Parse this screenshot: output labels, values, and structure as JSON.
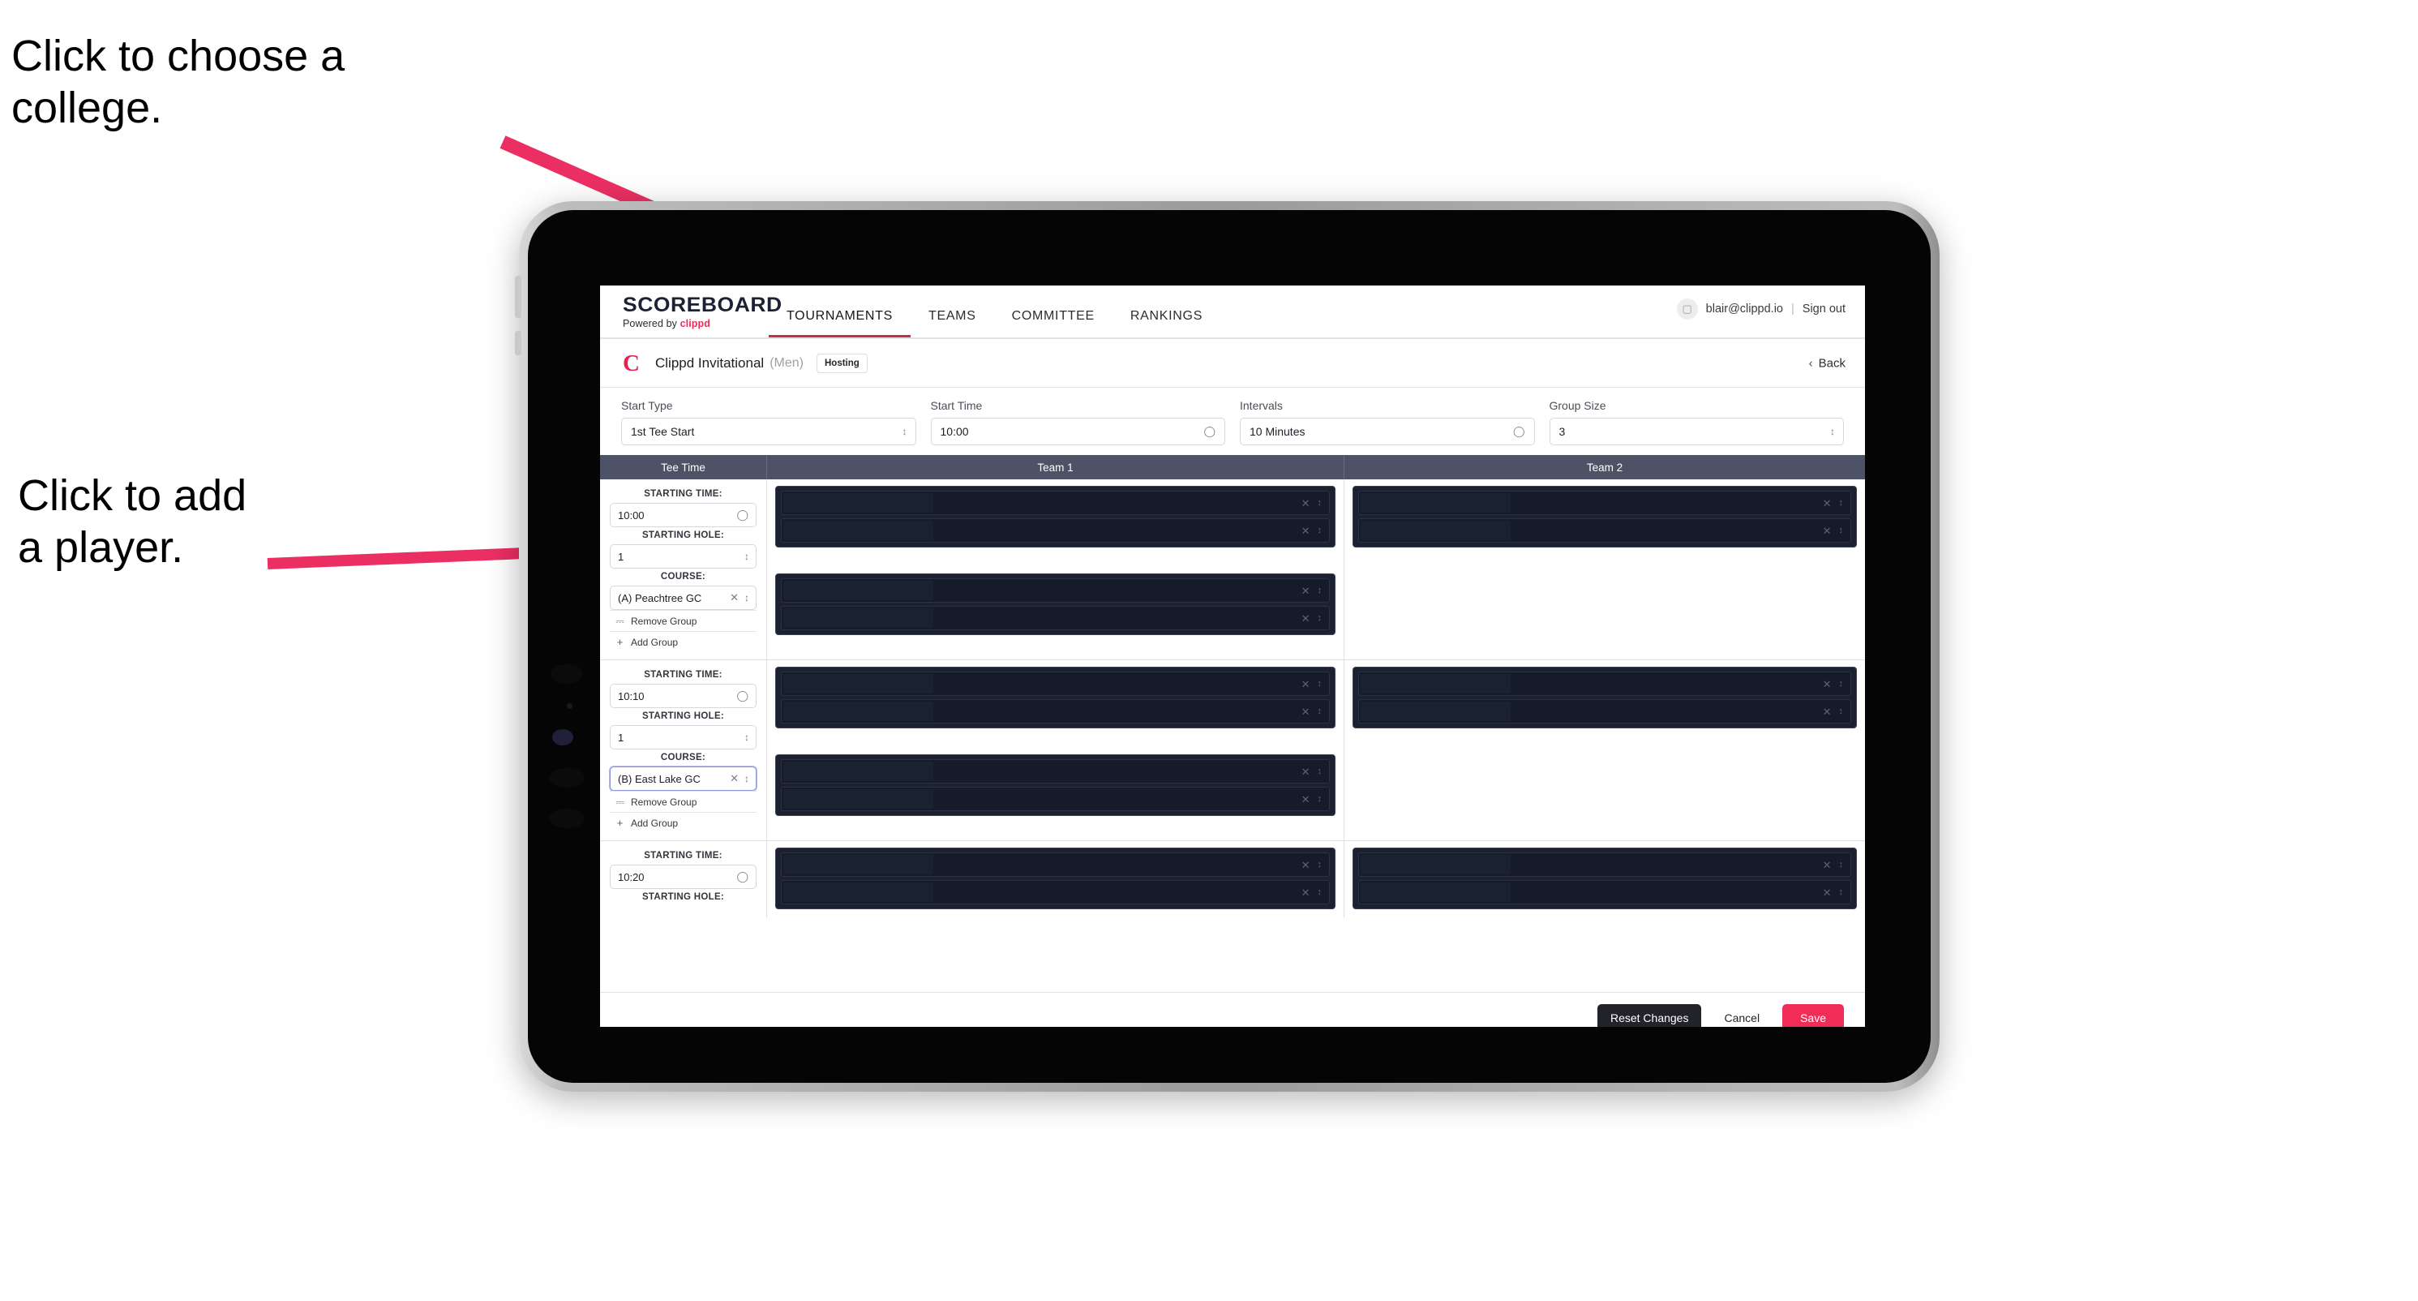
{
  "annotations": {
    "college": "Click to choose a\ncollege.",
    "player": "Click to add\na player.",
    "arrow_color": "#ec2f63"
  },
  "brand": {
    "wordmark": "SCOREBOARD",
    "tagline_prefix": "Powered by ",
    "tagline_brand": "clippd"
  },
  "nav": {
    "tabs": [
      {
        "label": "TOURNAMENTS",
        "active": true
      },
      {
        "label": "TEAMS",
        "active": false
      },
      {
        "label": "COMMITTEE",
        "active": false
      },
      {
        "label": "RANKINGS",
        "active": false
      }
    ]
  },
  "account": {
    "avatar_icon": "user-badge-icon",
    "email": "blair@clippd.io",
    "separator": "|",
    "sign_out": "Sign out"
  },
  "tournament": {
    "logo_letter": "C",
    "name": "Clippd Invitational",
    "gender": "(Men)",
    "badge": "Hosting",
    "back_label": "Back",
    "back_icon": "chevron-left-icon"
  },
  "settings": {
    "fields": [
      {
        "label": "Start Type",
        "value": "1st Tee Start",
        "icon": "stepper-icon"
      },
      {
        "label": "Start Time",
        "value": "10:00",
        "icon": "clock-icon"
      },
      {
        "label": "Intervals",
        "value": "10 Minutes",
        "icon": "clock-icon"
      },
      {
        "label": "Group Size",
        "value": "3",
        "icon": "stepper-icon"
      }
    ]
  },
  "table": {
    "headers": {
      "tee_time": "Tee Time",
      "team1": "Team 1",
      "team2": "Team 2"
    },
    "labels": {
      "starting_time": "STARTING TIME:",
      "starting_hole": "STARTING HOLE:",
      "course": "COURSE:",
      "remove_group": "Remove Group",
      "add_group": "Add Group",
      "remove_group_icon": "trash-icon",
      "add_group_icon": "plus-icon",
      "clock_icon": "clock-icon",
      "stepper_icon": "stepper-icon",
      "clear_icon": "close-x-icon",
      "player_clear_icon": "close-x-icon",
      "player_stepper_icon": "stepper-icon"
    },
    "rows": [
      {
        "starting_time": "10:00",
        "starting_hole": "1",
        "course": "(A) Peachtree GC",
        "course_focused": false,
        "team1_groups": [
          {
            "players": [
              "",
              ""
            ]
          },
          {
            "players": [
              "",
              ""
            ]
          }
        ],
        "team2_groups": [
          {
            "players": [
              "",
              ""
            ]
          }
        ]
      },
      {
        "starting_time": "10:10",
        "starting_hole": "1",
        "course": "(B) East Lake GC",
        "course_focused": true,
        "team1_groups": [
          {
            "players": [
              "",
              ""
            ]
          },
          {
            "players": [
              "",
              ""
            ]
          }
        ],
        "team2_groups": [
          {
            "players": [
              "",
              ""
            ]
          }
        ]
      },
      {
        "starting_time": "10:20",
        "starting_hole": "",
        "course": "",
        "course_focused": false,
        "team1_groups": [
          {
            "players": [
              "",
              ""
            ]
          }
        ],
        "team2_groups": [
          {
            "players": [
              "",
              ""
            ]
          }
        ]
      }
    ]
  },
  "footer": {
    "reset": "Reset Changes",
    "cancel": "Cancel",
    "save": "Save",
    "save_color": "#ef2d56"
  }
}
